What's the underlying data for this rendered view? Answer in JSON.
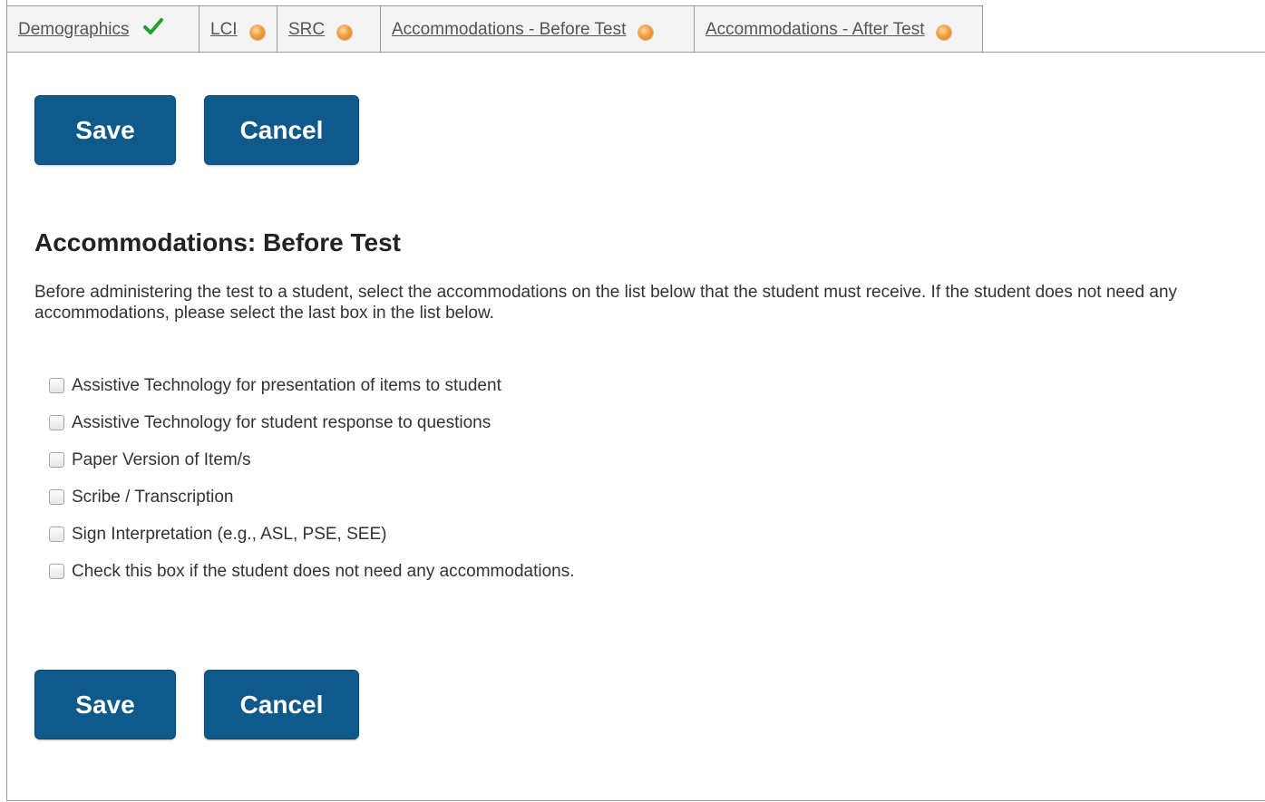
{
  "tabs": [
    {
      "label": "Demographics",
      "status": "complete",
      "status_icon": "check-icon",
      "status_color": "#22a02c"
    },
    {
      "label": "LCI",
      "status": "incomplete",
      "status_icon": "dot-icon",
      "status_color": "#f2a03c"
    },
    {
      "label": "SRC",
      "status": "incomplete",
      "status_icon": "dot-icon",
      "status_color": "#f2a03c"
    },
    {
      "label": "Accommodations - Before Test",
      "status": "incomplete",
      "status_icon": "dot-icon",
      "status_color": "#f2a03c"
    },
    {
      "label": "Accommodations - After Test",
      "status": "incomplete",
      "status_icon": "dot-icon",
      "status_color": "#f2a03c"
    }
  ],
  "actions": {
    "save_label": "Save",
    "cancel_label": "Cancel"
  },
  "section": {
    "title": "Accommodations: Before Test",
    "instructions": "Before administering the test to a student, select the accommodations on the list below that the student must receive. If the student does not need any accommodations, please select the last box in the list below."
  },
  "options": [
    {
      "label": "Assistive Technology for presentation of items to student",
      "checked": false
    },
    {
      "label": "Assistive Technology for student response to questions",
      "checked": false
    },
    {
      "label": "Paper Version of Item/s",
      "checked": false
    },
    {
      "label": "Scribe / Transcription",
      "checked": false
    },
    {
      "label": "Sign Interpretation (e.g., ASL, PSE, SEE)",
      "checked": false
    },
    {
      "label": "Check this box if the student does not need any accommodations.",
      "checked": false
    }
  ],
  "colors": {
    "button_bg": "#0f5a8a",
    "button_text": "#ffffff",
    "complete": "#22a02c",
    "incomplete": "#f2a03c"
  }
}
